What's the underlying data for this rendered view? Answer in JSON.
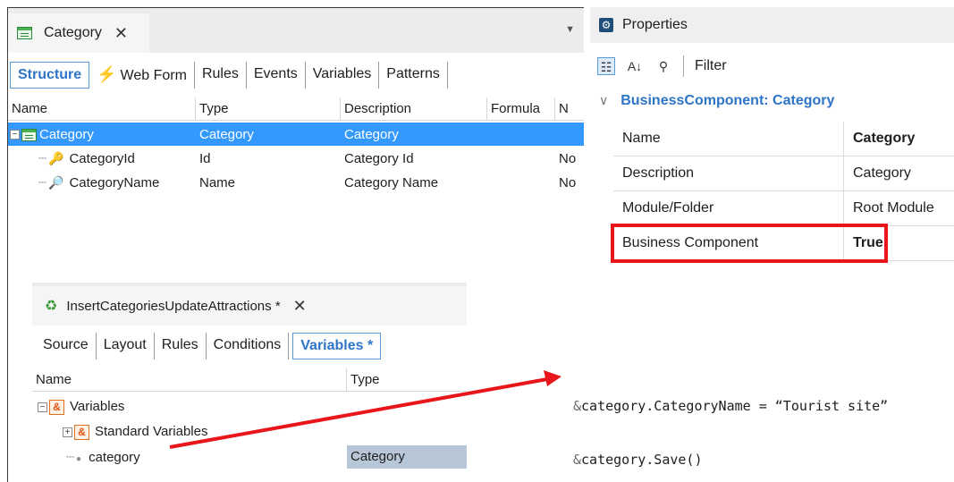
{
  "top_editor": {
    "tab_title": "Category",
    "close_glyph": "✕",
    "dropdown_glyph": "▼",
    "subtabs": [
      "Structure",
      "Web Form",
      "Rules",
      "Events",
      "Variables",
      "Patterns"
    ],
    "columns": [
      "Name",
      "Type",
      "Description",
      "Formula",
      "N"
    ],
    "rows": [
      {
        "name": "Category",
        "type": "Category",
        "description": "Category",
        "formula": "",
        "n": ""
      },
      {
        "name": "CategoryId",
        "type": "Id",
        "description": "Category Id",
        "formula": "",
        "n": "No"
      },
      {
        "name": "CategoryName",
        "type": "Name",
        "description": "Category Name",
        "formula": "",
        "n": "No"
      }
    ]
  },
  "properties": {
    "title": "Properties",
    "filter_label": "Filter",
    "section": "BusinessComponent: Category",
    "rows": [
      {
        "name": "Name",
        "value": "Category"
      },
      {
        "name": "Description",
        "value": "Category"
      },
      {
        "name": "Module/Folder",
        "value": "Root Module"
      },
      {
        "name": "Business Component",
        "value": "True"
      }
    ]
  },
  "bottom_editor": {
    "tab_title": "InsertCategoriesUpdateAttractions",
    "modified_mark": "*",
    "close_glyph": "✕",
    "subtabs": [
      "Source",
      "Layout",
      "Rules",
      "Conditions",
      "Variables *"
    ],
    "columns": [
      "Name",
      "Type"
    ],
    "tree": {
      "root": "Variables",
      "standard": "Standard Variables",
      "item_name": "category",
      "item_type": "Category"
    }
  },
  "code": {
    "line1_prefix": "&",
    "line1_rest": "category.CategoryName = “Tourist site”",
    "line2_prefix": "&",
    "line2_rest": "category.Save()"
  },
  "colors": {
    "accent_blue": "#2e75c7",
    "selection_blue": "#3399ff",
    "highlight_red": "#e8161a"
  }
}
